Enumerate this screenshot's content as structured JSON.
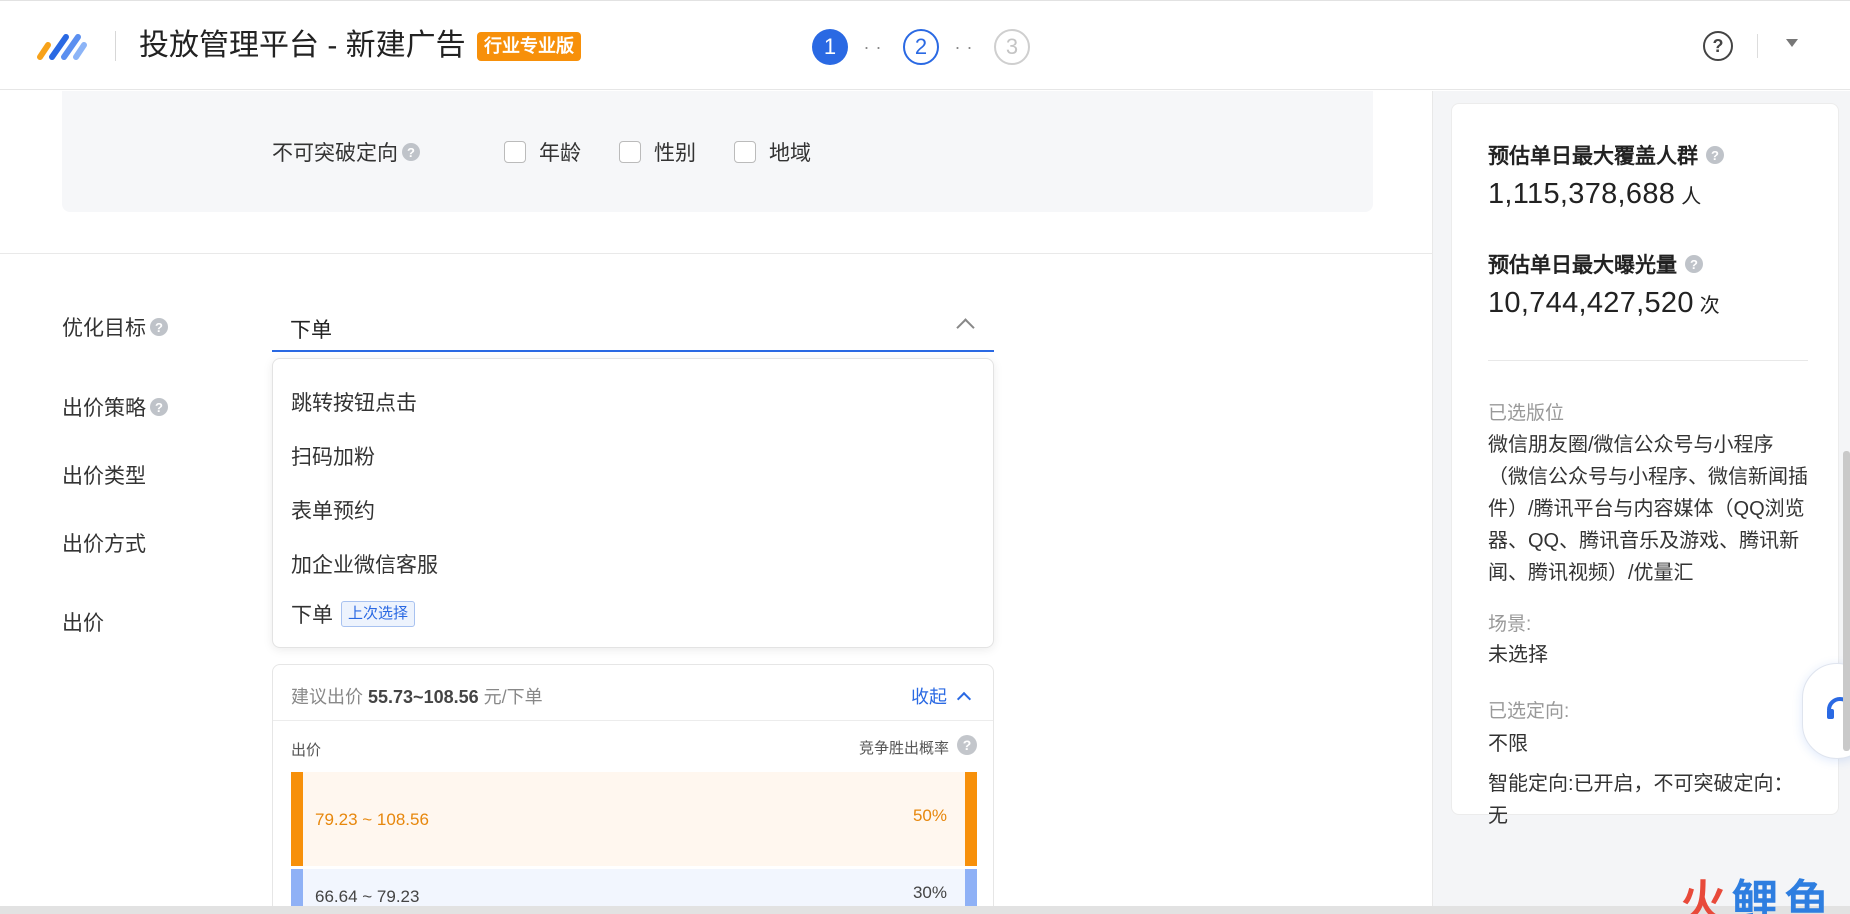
{
  "header": {
    "title": "投放管理平台 - 新建广告",
    "badge": "行业专业版",
    "steps": [
      "1",
      "2",
      "3"
    ],
    "step_dots": "··"
  },
  "targeting": {
    "label": "不可突破定向",
    "options": [
      "年龄",
      "性别",
      "地域"
    ]
  },
  "form": {
    "labels": {
      "opt_goal": "优化目标",
      "bid_strategy": "出价策略",
      "bid_type": "出价类型",
      "bid_method": "出价方式",
      "bid": "出价"
    },
    "opt_goal_value": "下单",
    "dropdown_options": [
      "跳转按钮点击",
      "扫码加粉",
      "表单预约",
      "加企业微信客服",
      "下单"
    ],
    "last_choice_tag": "上次选择"
  },
  "bid_panel": {
    "suggest_prefix": "建议出价",
    "suggest_range": "55.73~108.56",
    "suggest_unit": "元/下单",
    "collapse": "收起",
    "col_bid": "出价",
    "col_win_rate": "竞争胜出概率",
    "bands": [
      {
        "range": "79.23 ~ 108.56",
        "pct": "50%"
      },
      {
        "range": "66.64 ~ 79.23",
        "pct": "30%"
      }
    ]
  },
  "summary": {
    "coverage_title": "预估单日最大覆盖人群",
    "coverage_value": "1,115,378,688",
    "coverage_unit": "人",
    "exposure_title": "预估单日最大曝光量",
    "exposure_value": "10,744,427,520",
    "exposure_unit": "次",
    "placements_label": "已选版位",
    "placements_text": "微信朋友圈/微信公众号与小程序（微信公众号与小程序、微信新闻插件）/腾讯平台与内容媒体（QQ浏览器、QQ、腾讯音乐及游戏、腾讯新闻、腾讯视频）/优量汇",
    "scene_label": "场景:",
    "scene_value": "未选择",
    "targeting_label": "已选定向:",
    "targeting_value": "不限",
    "smart_targeting": "智能定向:已开启，不可突破定向：无"
  },
  "watermark": {
    "part1": "火",
    "part2": "鲤鱼"
  },
  "icons": [
    "logo-icon",
    "help-icon",
    "caret-down-icon",
    "question-icon",
    "chevron-up-icon",
    "support-icon"
  ],
  "colors": {
    "accent": "#2a69e3",
    "badge": "#f7900a",
    "band_orange": "#f7900a",
    "band_blue": "#8fb1f6"
  }
}
